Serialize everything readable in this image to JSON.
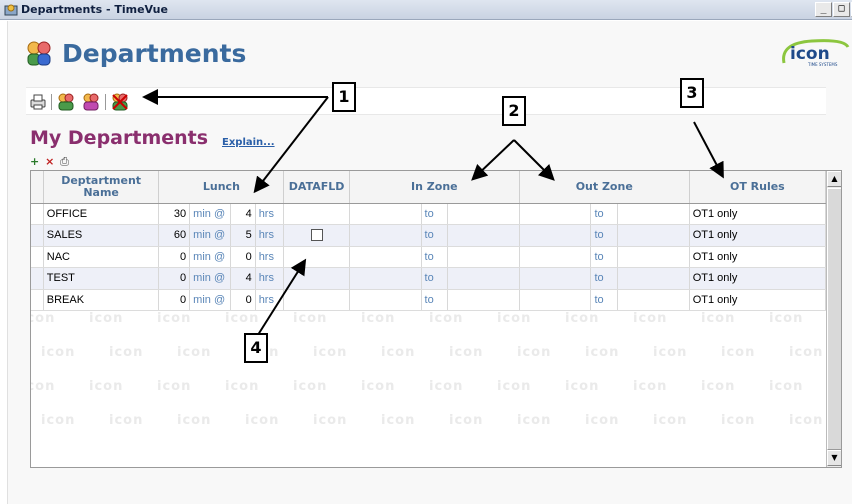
{
  "window": {
    "title": "Departments - TimeVue",
    "buttons": {
      "minimize": "_",
      "maximize": "□",
      "close": "×"
    }
  },
  "page": {
    "title": "Departments",
    "logo_text": "icon",
    "logo_sub": "TIME SYSTEMS"
  },
  "toolbar": {
    "icons": [
      "print-icon",
      "add-department-icon",
      "edit-department-icon",
      "delete-department-icon"
    ]
  },
  "section": {
    "title": "My Departments",
    "explain_link": "Explain...",
    "mini_actions": {
      "add": "+",
      "remove": "×",
      "print": "⎙"
    }
  },
  "table": {
    "headers": {
      "name": "Deptartment Name",
      "lunch": "Lunch",
      "datafld": "DATAFLD",
      "in_zone": "In Zone",
      "out_zone": "Out Zone",
      "ot_rules": "OT Rules"
    },
    "rows": [
      {
        "name": "OFFICE",
        "lunch_min": "30",
        "min_label": "min @",
        "lunch_hrs": "4",
        "hrs_label": "hrs",
        "datafld_checkbox": false,
        "in_to": "to",
        "out_to": "to",
        "ot_rules": "OT1 only"
      },
      {
        "name": "SALES",
        "lunch_min": "60",
        "min_label": "min @",
        "lunch_hrs": "5",
        "hrs_label": "hrs",
        "datafld_checkbox": true,
        "in_to": "to",
        "out_to": "to",
        "ot_rules": "OT1 only"
      },
      {
        "name": "NAC",
        "lunch_min": "0",
        "min_label": "min @",
        "lunch_hrs": "0",
        "hrs_label": "hrs",
        "datafld_checkbox": false,
        "in_to": "to",
        "out_to": "to",
        "ot_rules": "OT1 only"
      },
      {
        "name": "TEST",
        "lunch_min": "0",
        "min_label": "min @",
        "lunch_hrs": "4",
        "hrs_label": "hrs",
        "datafld_checkbox": false,
        "in_to": "to",
        "out_to": "to",
        "ot_rules": "OT1 only"
      },
      {
        "name": "BREAK",
        "lunch_min": "0",
        "min_label": "min @",
        "lunch_hrs": "0",
        "hrs_label": "hrs",
        "datafld_checkbox": false,
        "in_to": "to",
        "out_to": "to",
        "ot_rules": "OT1 only"
      }
    ]
  },
  "watermark_text": "icon",
  "callouts": [
    "1",
    "2",
    "3",
    "4"
  ],
  "colors": {
    "title_blue": "#3a6a9e",
    "section_purple": "#8a2f6e",
    "header_blue": "#4a6f97",
    "link_blue": "#2a5fa8",
    "logo_green": "#8cc63f"
  }
}
